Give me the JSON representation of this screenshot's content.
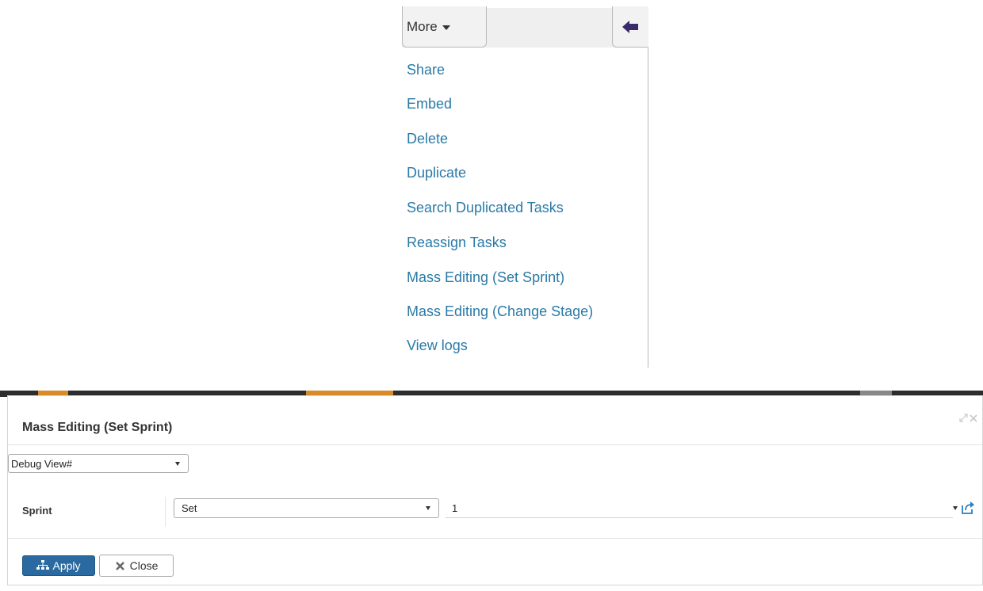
{
  "toolbar": {
    "more_label": "More",
    "caret_icon": "caret-down-icon",
    "back_icon": "arrow-left-icon",
    "accent_color": "#3b2a6b"
  },
  "dropdown": {
    "items": [
      {
        "label": "Share"
      },
      {
        "label": "Embed"
      },
      {
        "label": "Delete"
      },
      {
        "label": "Duplicate"
      },
      {
        "label": "Search Duplicated Tasks"
      },
      {
        "label": "Reassign Tasks"
      },
      {
        "label": "Mass Editing (Set Sprint)"
      },
      {
        "label": "Mass Editing (Change Stage)"
      },
      {
        "label": "View logs"
      }
    ],
    "link_color": "#2a7aa6"
  },
  "modal": {
    "title": "Mass Editing (Set Sprint)",
    "controls": {
      "maximize_icon": "expand-icon",
      "close_icon": "close-icon"
    },
    "view_select": {
      "value": "Debug View#"
    },
    "field": {
      "label": "Sprint",
      "operation": "Set",
      "value": "1",
      "link_icon": "open-external-icon"
    },
    "buttons": {
      "apply_label": "Apply",
      "close_label": "Close",
      "apply_color": "#2b6aa0"
    }
  }
}
